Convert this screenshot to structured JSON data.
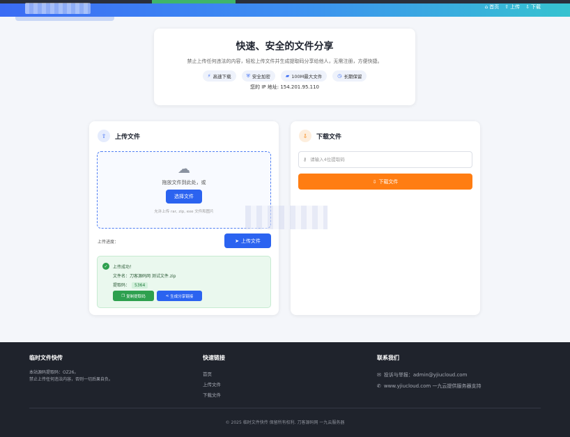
{
  "header": {
    "nav": [
      {
        "icon": "home-icon",
        "glyph": "⌂",
        "label": "首页"
      },
      {
        "icon": "upload-icon",
        "glyph": "⇧",
        "label": "上传"
      },
      {
        "icon": "download-icon",
        "glyph": "⇩",
        "label": "下载"
      }
    ]
  },
  "hero": {
    "title": "快速、安全的文件分享",
    "description": "禁止上传任何违法的内容，轻松上传文件并生成提取码分享给他人，无需注册，方便快捷。",
    "features": [
      {
        "icon": "bolt-icon",
        "glyph": "⚡",
        "label": "高速下载"
      },
      {
        "icon": "shield-icon",
        "glyph": "⛨",
        "label": "安全加密"
      },
      {
        "icon": "truck-icon",
        "glyph": "▰",
        "label": "100M最大文件"
      },
      {
        "icon": "clock-icon",
        "glyph": "◷",
        "label": "长期保留"
      }
    ],
    "ip_text": "您的 IP 地址: 154.201.95.110"
  },
  "upload": {
    "title": "上传文件",
    "drop_text": "拖放文件到此处，或",
    "select_button": "选择文件",
    "hint": "允许上传 rar, zip, exe 文件和图片",
    "progress_label": "上传进度：",
    "upload_button": "上传文件",
    "success": {
      "title": "上传成功！",
      "file_line": "文件名：刀客源码网 测试文件.zip",
      "code_label": "提取码：",
      "code_value": "5364",
      "copy_button": "复制提取码",
      "share_button": "生成分享链接"
    }
  },
  "download": {
    "title": "下载文件",
    "input_placeholder": "请输入4位提取码",
    "input_value": "",
    "download_button": "下载文件"
  },
  "footer": {
    "about": {
      "title": "临时文件快传",
      "lines": [
        "本站源码提取码：OZ26。",
        "禁止上传任何违法内容，否则一切后果自负。"
      ]
    },
    "links": {
      "title": "快速链接",
      "items": [
        "首页",
        "上传文件",
        "下载文件"
      ]
    },
    "contact": {
      "title": "联系我们",
      "email": "投诉与举报：admin@yjiucloud.com",
      "site": "www.yjiucloud.com 一九云提供服务器支持"
    },
    "copyright": "© 2025 临时文件快传 保留所有权利. 刀客源码网 一九云服务器"
  },
  "colors": {
    "primary": "#2b63f0",
    "accent_orange": "#ff7d12",
    "success_green": "#2ea04f",
    "footer_bg": "#1f232c"
  }
}
